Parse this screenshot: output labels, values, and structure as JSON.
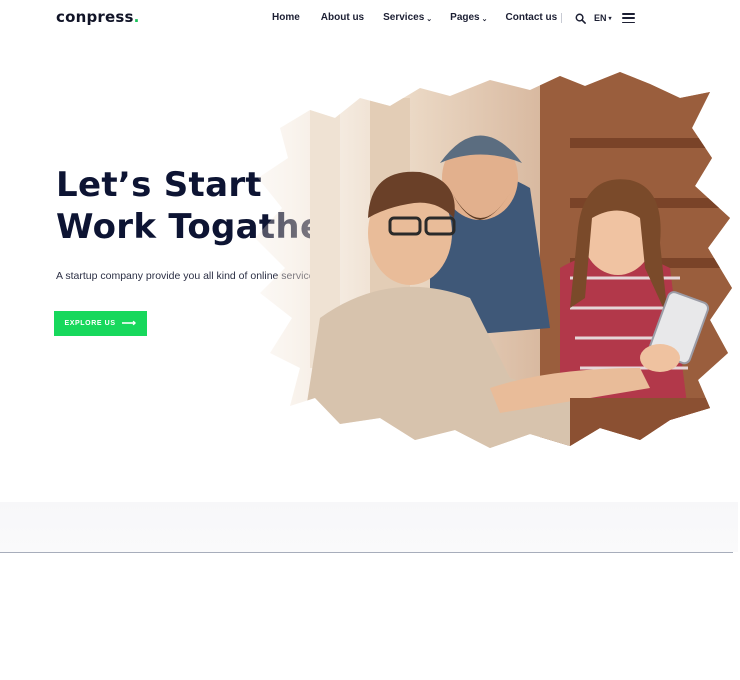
{
  "brand": {
    "name_main": "conpress",
    "name_accent": ".",
    "accent_color": "#19c35a"
  },
  "nav": {
    "home": "Home",
    "about": "About us",
    "services": "Services",
    "pages": "Pages",
    "contact": "Contact us",
    "chevron": "⌄"
  },
  "header_tools": {
    "language": "EN",
    "language_caret": "▾",
    "search_icon": "search-icon",
    "menu_icon": "menu-icon"
  },
  "hero": {
    "title_line1": "Let’s Start",
    "title_line2": "Work Togather",
    "subtitle": "A startup company provide you all kind of online services",
    "cta_label": "EXPLORE US",
    "cta_arrow": "⟶",
    "cta_color": "#17d85c",
    "title_color": "#0d1433"
  }
}
